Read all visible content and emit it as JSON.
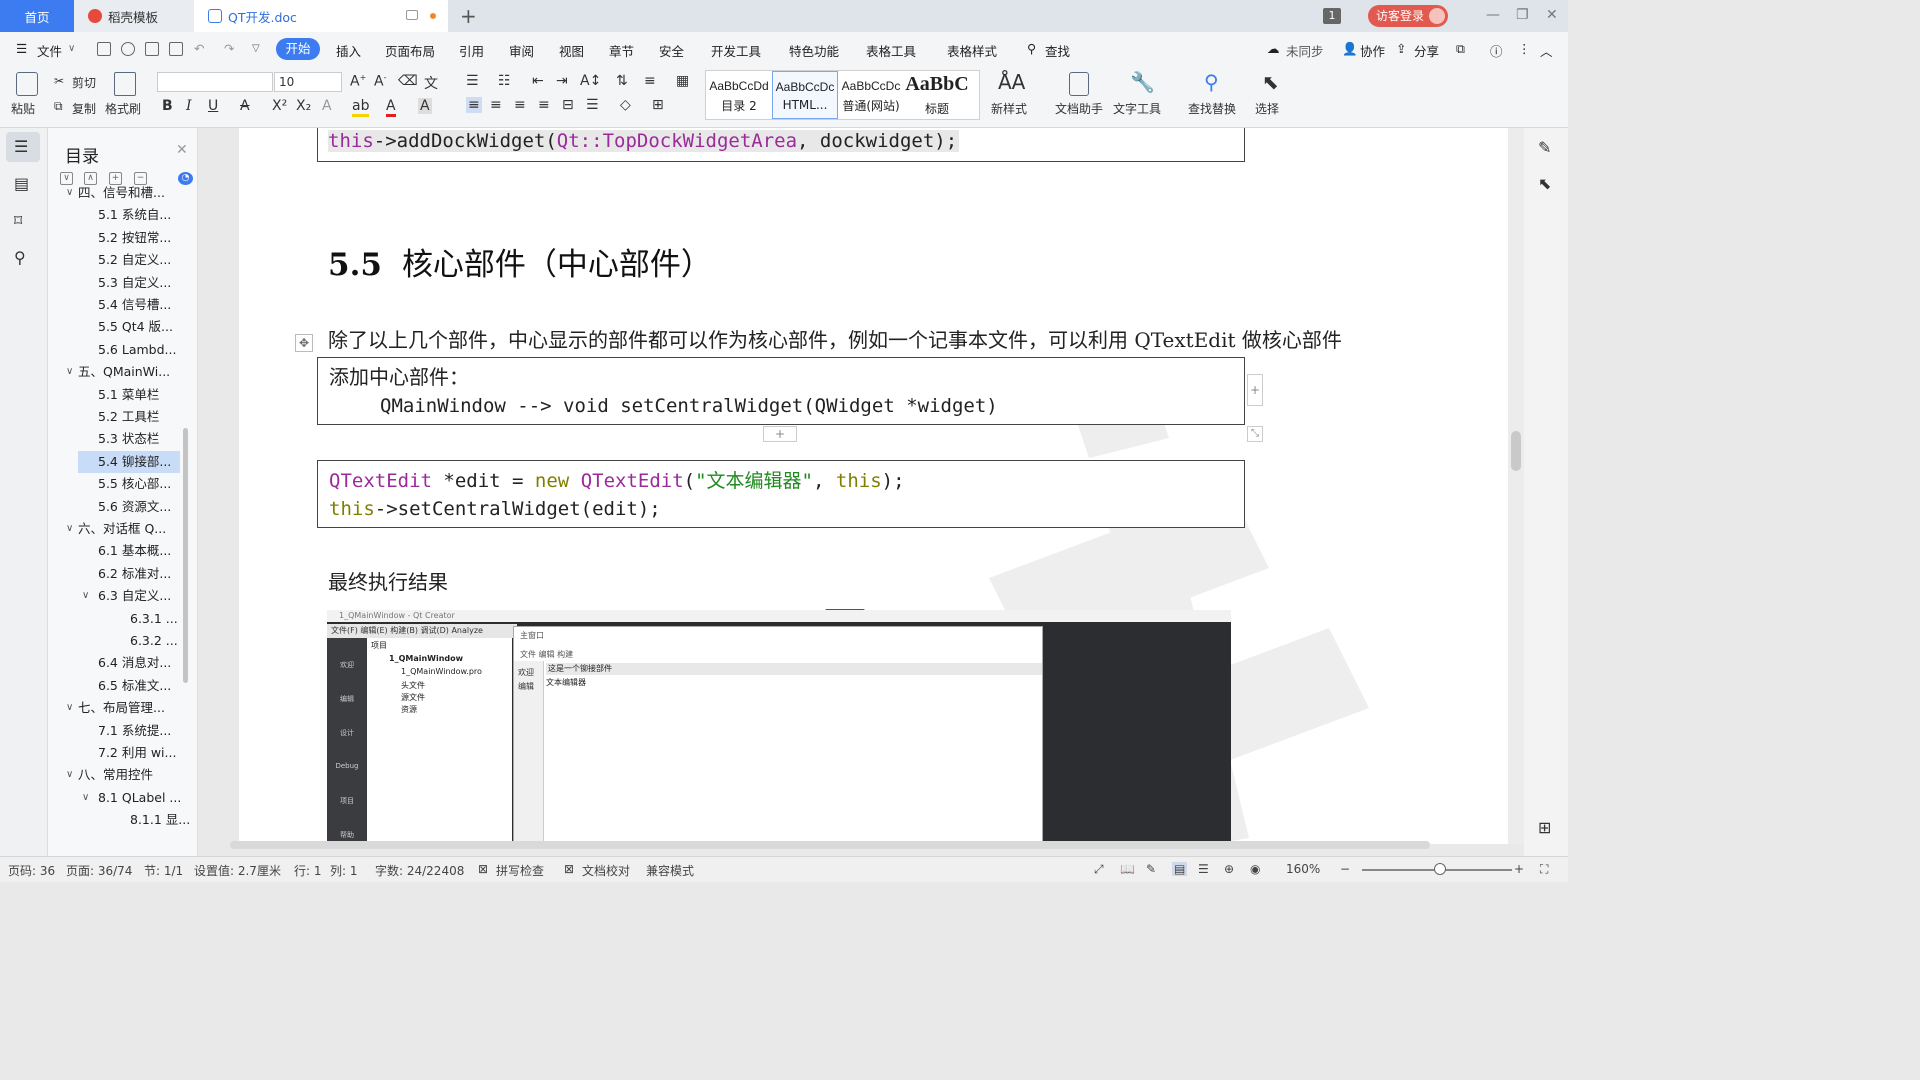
{
  "tabs": {
    "home": "首页",
    "template": "稻壳模板",
    "document": "QT开发.doc"
  },
  "titlebar": {
    "badge": "1",
    "login": "访客登录"
  },
  "menu": {
    "file": "文件",
    "items": [
      "开始",
      "插入",
      "页面布局",
      "引用",
      "审阅",
      "视图",
      "章节",
      "安全",
      "开发工具",
      "特色功能",
      "表格工具",
      "表格样式"
    ],
    "search": "查找",
    "sync": "未同步",
    "collab": "协作",
    "share": "分享"
  },
  "toolbar": {
    "paste": "粘贴",
    "cut": "剪切",
    "copy": "复制",
    "format_painter": "格式刷",
    "font_size": "10",
    "styles": [
      {
        "preview": "AaBbCcDd",
        "name": "目录 2"
      },
      {
        "preview": "AaBbCcDc",
        "name": "HTML..."
      },
      {
        "preview": "AaBbCcDc",
        "name": "普通(网站)"
      },
      {
        "preview": "AaBbC",
        "name": "标题"
      }
    ],
    "new_style": "新样式",
    "doc_helper": "文档助手",
    "text_tools": "文字工具",
    "find_replace": "查找替换",
    "select": "选择"
  },
  "toc": {
    "title": "目录",
    "items": [
      {
        "label": "四、信号和槽...",
        "level": 1
      },
      {
        "label": "5.1 系统自...",
        "level": 2
      },
      {
        "label": "5.2 按钮常...",
        "level": 2
      },
      {
        "label": "5.2 自定义...",
        "level": 2
      },
      {
        "label": "5.3 自定义...",
        "level": 2
      },
      {
        "label": "5.4 信号槽...",
        "level": 2
      },
      {
        "label": "5.5 Qt4 版...",
        "level": 2
      },
      {
        "label": "5.6 Lambd...",
        "level": 2
      },
      {
        "label": "五、QMainWi...",
        "level": 1
      },
      {
        "label": "5.1 菜单栏",
        "level": 2
      },
      {
        "label": "5.2 工具栏",
        "level": 2
      },
      {
        "label": "5.3 状态栏",
        "level": 2
      },
      {
        "label": "5.4 铆接部...",
        "level": 2,
        "active": true
      },
      {
        "label": "5.5 核心部...",
        "level": 2
      },
      {
        "label": "5.6 资源文...",
        "level": 2
      },
      {
        "label": "六、对话框 Q...",
        "level": 1
      },
      {
        "label": "6.1 基本概...",
        "level": 2
      },
      {
        "label": "6.2 标准对...",
        "level": 2
      },
      {
        "label": "6.3 自定义...",
        "level": 2,
        "expand": true
      },
      {
        "label": "6.3.1 ...",
        "level": 3
      },
      {
        "label": "6.3.2 ...",
        "level": 3
      },
      {
        "label": "6.4 消息对...",
        "level": 2
      },
      {
        "label": "6.5 标准文...",
        "level": 2
      },
      {
        "label": "七、布局管理...",
        "level": 1
      },
      {
        "label": "7.1 系统提...",
        "level": 2
      },
      {
        "label": "7.2 利用 wi...",
        "level": 2
      },
      {
        "label": "八、常用控件",
        "level": 1
      },
      {
        "label": "8.1 QLabel ...",
        "level": 2,
        "expand": true
      },
      {
        "label": "8.1.1 显...",
        "level": 3
      }
    ]
  },
  "doc": {
    "code_top": {
      "obj": "this",
      "rest1": "->addDockWidget(",
      "ns": "Qt::",
      "enum": "TopDockWidgetArea",
      "rest2": ", dockwidget);"
    },
    "heading_num": "5.5",
    "heading_text": "核心部件（中心部件）",
    "para1": "除了以上几个部件，中心显示的部件都可以作为核心部件，例如一个记事本文件，可以利用 QTextEdit 做核心部件",
    "box1_line1": "添加中心部件：",
    "box1_line2": "QMainWindow --> void setCentralWidget(QWidget *widget)",
    "code2": {
      "l1_type": "QTextEdit",
      "l1_a": " *edit = ",
      "l1_new": "new",
      "l1_b": " ",
      "l1_type2": "QTextEdit",
      "l1_c": "(",
      "l1_str": "\"文本编辑器\"",
      "l1_d": ", ",
      "l1_this": "this",
      "l1_e": ");",
      "l2_this": "this",
      "l2_rest": "->setCentralWidget(edit);"
    },
    "result_label": "最终执行结果",
    "shot": {
      "qc_title": "1_QMainWindow - Qt Creator",
      "qc_menu": "文件(F)  编辑(E)  构建(B)  调试(D)  Analyze",
      "qc_tree_header": "项目",
      "tree": [
        "1_QMainWindow",
        "1_QMainWindow.pro",
        "头文件",
        "源文件",
        "资源"
      ],
      "side": [
        "欢迎",
        "编辑",
        "设计",
        "Debug",
        "项目",
        "帮助"
      ],
      "mw_title": "主窗口",
      "mw_menu": "文件    编辑    构建",
      "mw_left": [
        "欢迎",
        "编辑"
      ],
      "dock_title": "这是一个铆接部件",
      "edit_text": "文本编辑器"
    }
  },
  "status": {
    "page": "页码: 36",
    "pages": "页面: 36/74",
    "section": "节: 1/1",
    "setting": "设置值: 2.7厘米",
    "row": "行: 1",
    "col": "列: 1",
    "words": "字数: 24/22408",
    "spell": "拼写检查",
    "proof": "文档校对",
    "compat": "兼容模式",
    "zoom": "160%"
  },
  "colors": {
    "accent": "#3c7cf0",
    "login": "#e25a4f",
    "keyword": "#9b2a9b",
    "string": "#1f8b1f",
    "toc_active": "#c9dcf7"
  }
}
